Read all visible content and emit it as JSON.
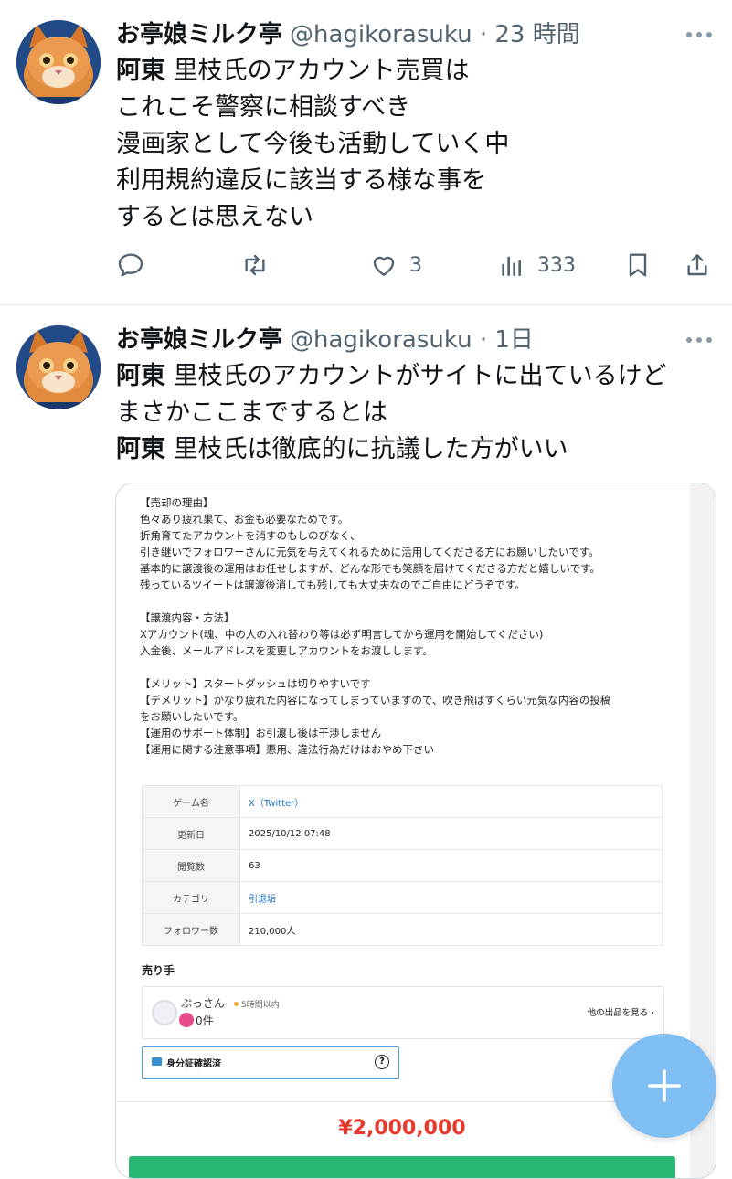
{
  "tweets": [
    {
      "display_name": "お亭娘ミルク亭",
      "handle_time": "@hagikorasuku · 23 時間",
      "lines": [
        {
          "bold": "阿東",
          "text": " 里枝氏のアカウント売買は"
        },
        {
          "bold": "",
          "text": "これこそ警察に相談すべき"
        },
        {
          "bold": "",
          "text": "漫画家として今後も活動していく中"
        },
        {
          "bold": "",
          "text": "利用規約違反に該当する様な事を"
        },
        {
          "bold": "",
          "text": "するとは思えない"
        }
      ],
      "likes": "3",
      "views": "333"
    },
    {
      "display_name": "お亭娘ミルク亭",
      "handle_time": "@hagikorasuku · 1日",
      "lines": [
        {
          "bold": "阿東",
          "text": " 里枝氏のアカウントがサイトに出ているけど"
        },
        {
          "bold": "",
          "text": "まさかここまでするとは"
        },
        {
          "bold": "阿東",
          "text": " 里枝氏は徹底的に抗議した方がいい"
        }
      ]
    }
  ],
  "listing": {
    "description": [
      "【売却の理由】",
      "色々あり疲れ果て、お金も必要なためです。",
      "折角育てたアカウントを消すのもしのびなく、",
      "引き継いでフォロワーさんに元気を与えてくれるために活用してくださる方にお願いしたいです。",
      "基本的に譲渡後の運用はお任せしますが、どんな形でも笑顔を届けてくださる方だと嬉しいです。",
      "残っているツイートは譲渡後消しても残しても大丈夫なのでご自由にどうぞです。",
      "",
      "【譲渡内容・方法】",
      "Xアカウント(魂、中の人の入れ替わり等は必ず明言してから運用を開始してください)",
      "入金後、メールアドレスを変更しアカウントをお渡しします。",
      "",
      "【メリット】スタートダッシュは切りやすいです",
      "【デメリット】かなり疲れた内容になってしまっていますので、吹き飛ばすくらい元気な内容の投稿",
      "をお願いしたいです。",
      "【運用のサポート体制】お引渡し後は干渉しません",
      "【運用に関する注意事項】悪用、違法行為だけはおやめ下さい"
    ],
    "table": [
      {
        "key": "ゲーム名",
        "value": "X（Twitter）"
      },
      {
        "key": "更新日",
        "value": "2025/10/12 07:48"
      },
      {
        "key": "閲覧数",
        "value": "63"
      },
      {
        "key": "カテゴリ",
        "value": "引退垢"
      },
      {
        "key": "フォロワー数",
        "value": "210,000人"
      }
    ],
    "seller_heading": "売り手",
    "seller_name": "ぷっさん",
    "seller_status": "5時間以内",
    "seller_count": "0件",
    "seller_link": "他の出品を見る ›",
    "id_verified": "身分証確認済",
    "id_help": "?",
    "price": "¥2,000,000"
  },
  "colors": {
    "accent": "#1d9bf0",
    "price": "#e8382b",
    "fab": "#78bbf2"
  },
  "icons": [
    "reply-icon",
    "retweet-icon",
    "like-icon",
    "views-icon",
    "bookmark-icon",
    "share-icon",
    "more-icon",
    "plus-icon"
  ]
}
